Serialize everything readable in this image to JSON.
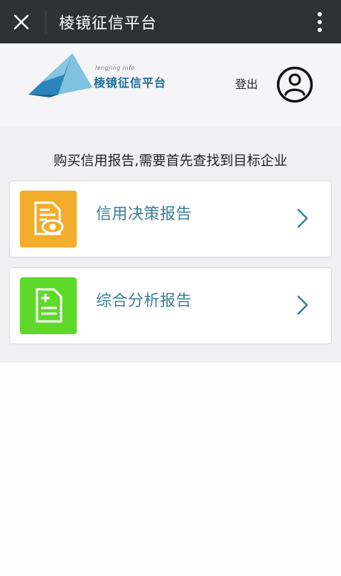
{
  "topbar": {
    "title": "棱镜征信平台",
    "close_icon": "close-icon",
    "more_icon": "more-vertical-icon"
  },
  "header": {
    "logo_subtext": "lengjing info",
    "logo_text": "棱镜征信平台",
    "logout_label": "登出",
    "avatar_icon": "user-circle-icon"
  },
  "main": {
    "hint": "购买信用报告,需要首先查找到目标企业",
    "cards": [
      {
        "label": "信用决策报告",
        "icon": "report-eye-icon",
        "color": "#f2ad2c"
      },
      {
        "label": "综合分析报告",
        "icon": "document-plus-icon",
        "color": "#5ed92a"
      }
    ]
  },
  "colors": {
    "topbar": "#2f3135",
    "accent_text": "#3a7f95"
  }
}
